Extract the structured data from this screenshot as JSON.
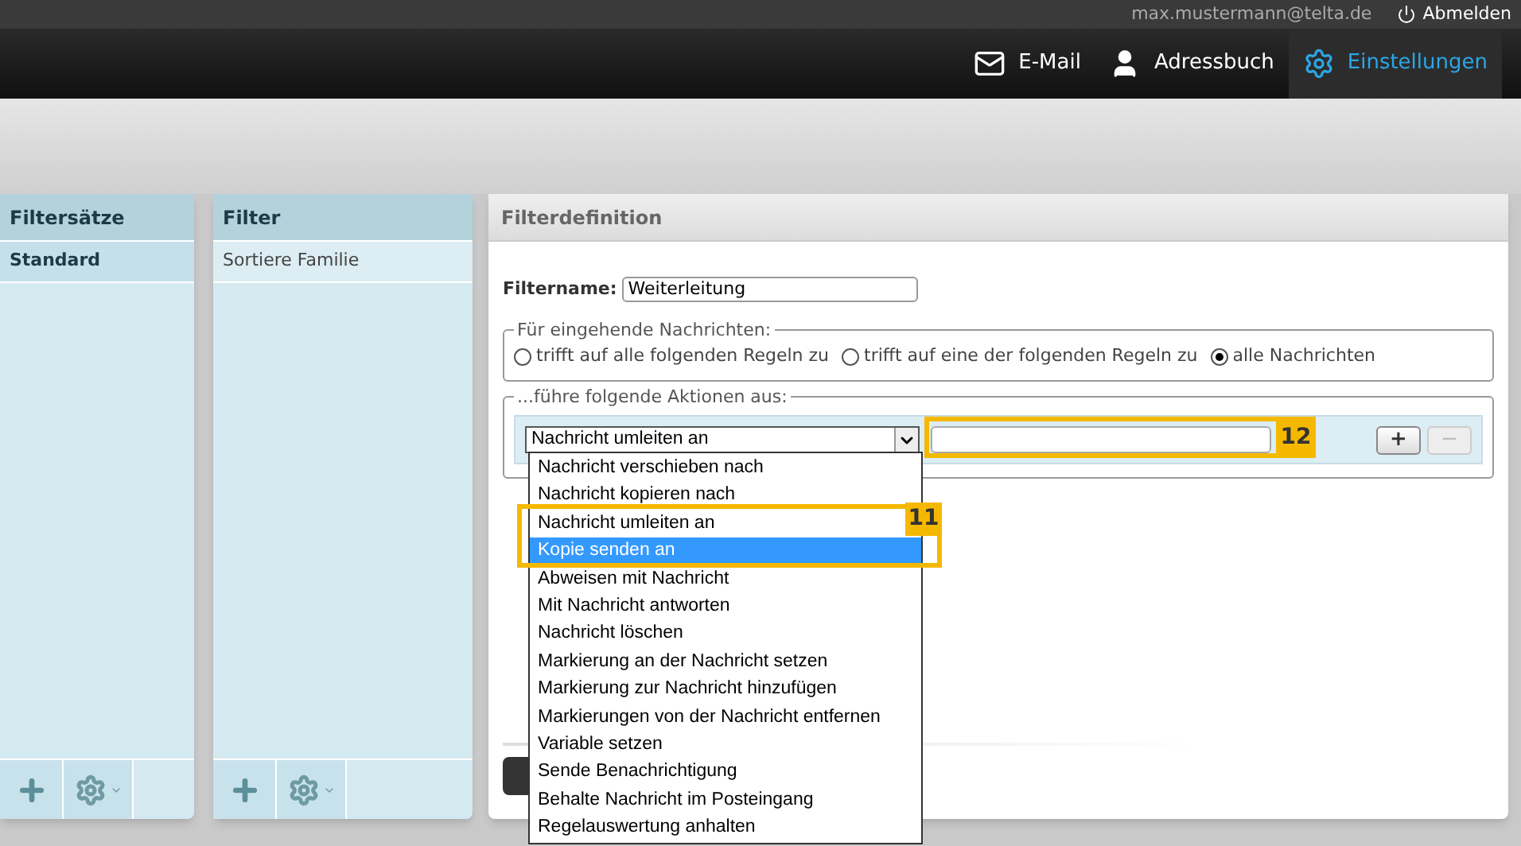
{
  "header": {
    "user": "max.mustermann@telta.de",
    "logout": "Abmelden"
  },
  "nav": [
    {
      "kind": "mail",
      "label": "E-Mail",
      "selected": false
    },
    {
      "kind": "person",
      "label": "Adressbuch",
      "selected": false
    },
    {
      "kind": "gear",
      "label": "Einstellungen",
      "selected": true
    }
  ],
  "filter_sets": {
    "title": "Filtersätze",
    "items": [
      {
        "label": "Standard",
        "selected": true
      }
    ]
  },
  "filters": {
    "title": "Filter",
    "items": [
      {
        "label": "Sortiere Familie",
        "selected": false
      }
    ]
  },
  "definition": {
    "title": "Filterdefinition",
    "name_label": "Filtername:",
    "name_value": "Weiterleitung",
    "incoming": {
      "legend": "Für eingehende Nachrichten:",
      "options": [
        {
          "label": "trifft auf alle folgenden Regeln zu",
          "selected": false
        },
        {
          "label": "trifft auf eine der folgenden Regeln zu",
          "selected": false
        },
        {
          "label": "alle Nachrichten",
          "selected": true
        }
      ]
    },
    "actions": {
      "legend": "...führe folgende Aktionen aus:",
      "select_value": "Nachricht umleiten an",
      "add": {
        "label": "+",
        "disabled": false
      },
      "remove": {
        "label": "−",
        "disabled": true
      },
      "dropdown": [
        {
          "label": "Nachricht verschieben nach",
          "selected": false
        },
        {
          "label": "Nachricht kopieren nach",
          "selected": false
        },
        {
          "label": "Nachricht umleiten an",
          "selected": false
        },
        {
          "label": "Kopie senden an",
          "selected": true
        },
        {
          "label": "Abweisen mit Nachricht",
          "selected": false
        },
        {
          "label": "Mit Nachricht antworten",
          "selected": false
        },
        {
          "label": "Nachricht löschen",
          "selected": false
        },
        {
          "label": "Markierung an der Nachricht setzen",
          "selected": false
        },
        {
          "label": "Markierung zur Nachricht hinzufügen",
          "selected": false
        },
        {
          "label": "Markierungen von der Nachricht entfernen",
          "selected": false
        },
        {
          "label": "Variable setzen",
          "selected": false
        },
        {
          "label": "Sende Benachrichtigung",
          "selected": false
        },
        {
          "label": "Behalte Nachricht im Posteingang",
          "selected": false
        },
        {
          "label": "Regelauswertung anhalten",
          "selected": false
        }
      ]
    }
  },
  "callouts": [
    {
      "label": "11"
    },
    {
      "label": "12"
    }
  ]
}
